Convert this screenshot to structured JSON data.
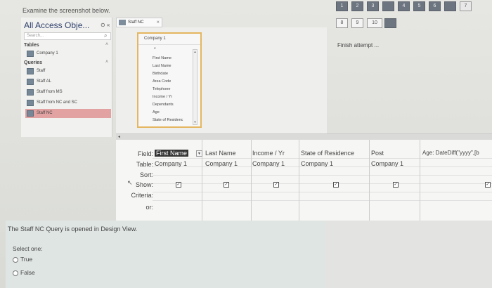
{
  "header": {
    "instruction": "Examine the screenshot below."
  },
  "question_nav": {
    "numbers": [
      "1",
      "2",
      "3",
      "4",
      "5",
      "6",
      "7",
      "8",
      "9",
      "10"
    ],
    "finish_label": "Finish attempt ..."
  },
  "access": {
    "nav_title": "All Access Obje...",
    "nav_controls": "⊙ «",
    "search_placeholder": "Search...",
    "groups": {
      "tables": "Tables",
      "queries": "Queries"
    },
    "tables": [
      "Company 1"
    ],
    "queries": [
      "Staff",
      "Staff AL",
      "Staff from MS",
      "Staff from NC and SC",
      "Staff NC"
    ],
    "selected_query": "Staff NC",
    "doc_tab": "Staff NC",
    "table_box": {
      "title": "Company 1",
      "star": "*",
      "fields": [
        "First Name",
        "Last Name",
        "Birthdate",
        "Area Code",
        "Telephone",
        "Income / Yr",
        "Dependants",
        "Age",
        "State of Residenc"
      ]
    },
    "grid": {
      "row_labels": [
        "Field:",
        "Table:",
        "Sort:",
        "Show:",
        "Criteria:",
        "or:"
      ],
      "columns": [
        {
          "field": "First Name",
          "table": "Company 1",
          "show": true
        },
        {
          "field": "Last Name",
          "table": "Company 1",
          "show": true
        },
        {
          "field": "Income / Yr",
          "table": "Company 1",
          "show": true
        },
        {
          "field": "State of Residence",
          "table": "Company 1",
          "show": true
        },
        {
          "field": "Post",
          "table": "Company 1",
          "show": true
        },
        {
          "field": "Age: DateDiff(\"yyyy\",[b",
          "table": "",
          "show": true
        }
      ]
    }
  },
  "question": {
    "statement": "The Staff NC Query is opened in Design View.",
    "select_one": "Select one:",
    "options": [
      "True",
      "False"
    ]
  }
}
